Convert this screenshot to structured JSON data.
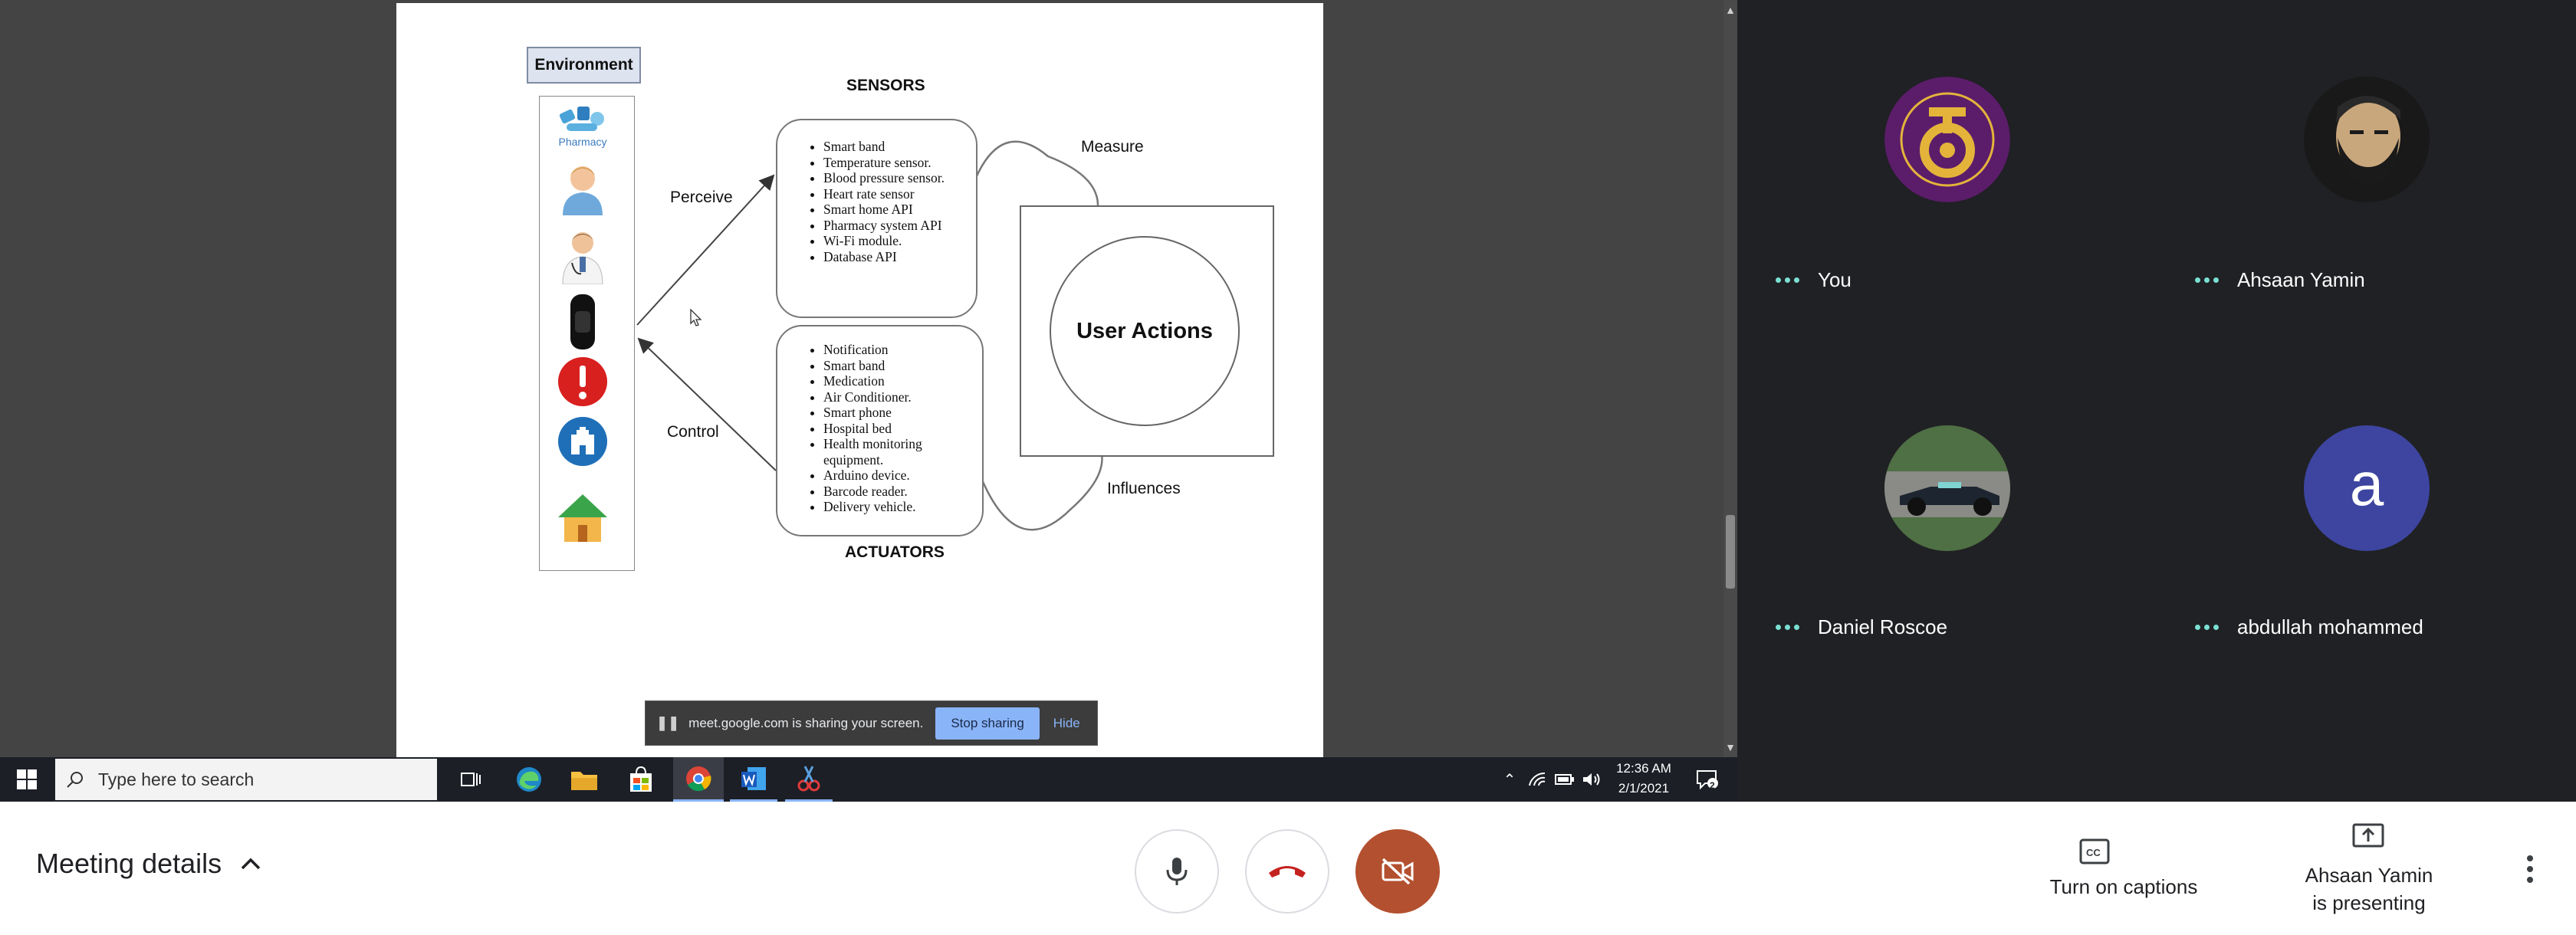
{
  "diagram": {
    "environment_label": "Environment",
    "pharmacy_caption": "Pharmacy",
    "sensors_title": "SENSORS",
    "sensors": [
      "Smart band",
      "Temperature sensor.",
      "Blood pressure sensor.",
      "Heart rate sensor",
      "Smart home API",
      "Pharmacy system API",
      "Wi-Fi module.",
      "Database API"
    ],
    "actuators_title": "ACTUATORS",
    "actuators": [
      "Notification",
      "Smart band",
      "Medication",
      "Air Conditioner.",
      "Smart phone",
      "Hospital bed",
      "Health monitoring equipment.",
      "Arduino device.",
      "Barcode reader.",
      "Delivery vehicle."
    ],
    "perceive": "Perceive",
    "control": "Control",
    "measure": "Measure",
    "influences": "Influences",
    "user_actions": "User Actions"
  },
  "share_bar": {
    "message": "meet.google.com is sharing your screen.",
    "stop": "Stop sharing",
    "hide": "Hide"
  },
  "taskbar": {
    "search_placeholder": "Type here to search",
    "time": "12:36 AM",
    "date": "2/1/2021",
    "notifications": "2"
  },
  "participants": [
    {
      "name": "You"
    },
    {
      "name": "Ahsaan Yamin"
    },
    {
      "name": "Daniel Roscoe"
    },
    {
      "name": "abdullah mohammed",
      "initial": "a"
    }
  ],
  "bottom_bar": {
    "meeting_details": "Meeting details",
    "captions": "Turn on captions",
    "presenting_line1": "Ahsaan Yamin",
    "presenting_line2": "is presenting"
  },
  "colors": {
    "end_call": "#c5221f",
    "camera_off": "#b3502f",
    "accent": "#8ab4f8",
    "avatar_a": "#3d45a0"
  }
}
